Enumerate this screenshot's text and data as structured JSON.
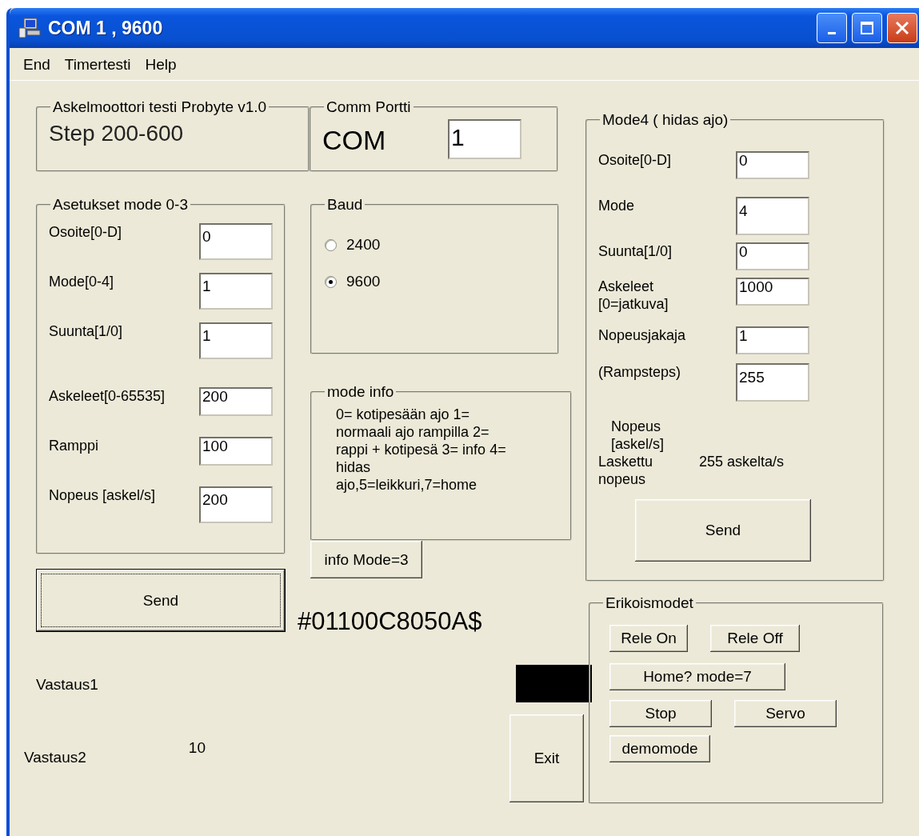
{
  "window": {
    "title": "COM 1 , 9600"
  },
  "menu": [
    "End",
    "Timertesti",
    "Help"
  ],
  "about_group": {
    "title": "Askelmoottori testi  Probyte v1.0",
    "text": "Step 200-600"
  },
  "port_group": {
    "title": "Comm Portti",
    "label": "COM",
    "value": "1"
  },
  "settings_group": {
    "title": "Asetukset mode 0-3",
    "fields": [
      {
        "label": "Osoite[0-D]",
        "value": "0"
      },
      {
        "label": "Mode[0-4]",
        "value": "1"
      },
      {
        "label": "Suunta[1/0]",
        "value": "1"
      },
      {
        "label": "Askeleet[0-65535]",
        "value": "200"
      },
      {
        "label": "Ramppi",
        "value": "100"
      },
      {
        "label": "Nopeus [askel/s]",
        "value": "200"
      }
    ]
  },
  "send_button": {
    "label": "Send",
    "focused": true
  },
  "baud_group": {
    "title": "Baud",
    "options": [
      {
        "label": "2400",
        "selected": false
      },
      {
        "label": "9600",
        "selected": true
      }
    ]
  },
  "mode_info": {
    "title": "mode info",
    "text": "0= kotipesään ajo 1= normaali ajo rampilla 2= rappi + kotipesä 3= info 4= hidas ajo,5=leikkuri,7=home"
  },
  "info_button": "info Mode=3",
  "command": "#01100C8050A$",
  "responses": [
    {
      "label": "Vastaus1"
    },
    {
      "label": "Vastaus2",
      "value": "10"
    }
  ],
  "exit_button": "Exit",
  "mode4_group": {
    "title": "Mode4 ( hidas ajo)",
    "fields": [
      {
        "label": "Osoite[0-D]",
        "value": "0"
      },
      {
        "label": "Mode",
        "value": "4"
      },
      {
        "label": "Suunta[1/0]",
        "value": "0"
      },
      {
        "label": "Askeleet [0=jatkuva]",
        "value": "1000"
      },
      {
        "label": "Nopeusjakaja",
        "value": "1"
      },
      {
        "label": "(Rampsteps)",
        "value": "255"
      }
    ],
    "speed_label": "Nopeus [askel/s]",
    "computed_label": "Laskettu nopeus",
    "computed_value": "255 askelta/s",
    "send_button": "Send"
  },
  "special_group": {
    "title": "Erikoismodet",
    "button_rows": [
      [
        "Rele On",
        "Rele Off"
      ],
      [
        "Home? mode=7"
      ],
      [
        "Stop",
        "Servo"
      ],
      [
        "demomode"
      ]
    ]
  }
}
